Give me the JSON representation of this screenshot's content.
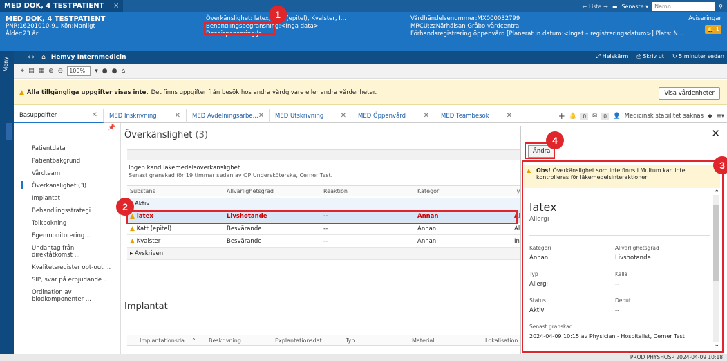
{
  "topbar": {
    "patient_tab": "MED DOK, 4 TESTPATIENT",
    "close": "×",
    "lista": "← Lista →",
    "senaste": "Senaste ▾",
    "search_placeholder": "Namn"
  },
  "header": {
    "patient_name": "MED DOK, 4 TESTPATIENT",
    "pnr": "PNR:16201010-9,, Kön:Manligt",
    "age": "Ålder:23 år",
    "allergy_line": "Överkänslighet: latex, Katt (epitel), Kvalster, I...",
    "treatment": "Behandlingsbegränsning:<Inga data>",
    "dose": "Dosdispensering:Ja",
    "visit_no": "Vårdhändelsenummer:MX000032799",
    "mrcu": "MRCU:zzNärhälsan Gråbo vårdcentral",
    "prereg": "Förhandsregistrering öppenvård [Planerat in.datum:<Inget – registreringsdatum>] Plats: N...",
    "aviseringar": "Aviseringar",
    "notif_count": "1"
  },
  "appbar": {
    "title": "Hemvy Internmedicin",
    "menu": "Meny",
    "helskarm": "Helskärm",
    "skriv_ut": "Skriv ut",
    "updated": "5 minuter sedan"
  },
  "toolbar": {
    "zoom": "100%"
  },
  "warning": {
    "bold": "Alla tillgängliga uppgifter visas inte.",
    "text": "Det finns uppgifter från besök hos andra vårdgivare eller andra vårdenheter.",
    "button": "Visa vårdenheter"
  },
  "tabs": [
    {
      "label": "Basuppgifter"
    },
    {
      "label": "MED Inskrivning"
    },
    {
      "label": "MED Avdelningsarbe..."
    },
    {
      "label": "MED Utskrivning"
    },
    {
      "label": "MED Öppenvård"
    },
    {
      "label": "MED Teambesök"
    }
  ],
  "tab_tools": {
    "plus": "+",
    "count1": "0",
    "count2": "0",
    "stability": "Medicinsk stabilitet saknas"
  },
  "sidebar": [
    "Patientdata",
    "Patientbakgrund",
    "Vårdteam",
    "Överkänslighet (3)",
    "Implantat",
    "Behandlingsstrategi",
    "Tolkbokning",
    "Egenmonitorering ...",
    "Undantag från",
    "direktåtkomst ...",
    "Kvalitetsregister opt-out ...",
    "SIP, svar på erbjudande ...",
    "Ordination av",
    "blodkomponenter ..."
  ],
  "main": {
    "title": "Överkänslighet",
    "count": "(3)",
    "no_med": "Ingen känd läkemedelsöverkänslighet",
    "reviewed": "Senast granskad för 19 timmar sedan av OP Undersköterska, Cerner Test.",
    "headers": [
      "Substans",
      "Allvarlighetsgrad",
      "Reaktion",
      "Kategori",
      "Ty"
    ],
    "group_active": "Aktiv",
    "rows": [
      {
        "sub": "latex",
        "sev": "Livshotande",
        "reac": "--",
        "cat": "Annan",
        "t": "Al"
      },
      {
        "sub": "Katt (epitel)",
        "sev": "Besvärande",
        "reac": "--",
        "cat": "Annan",
        "t": "Al"
      },
      {
        "sub": "Kvalster",
        "sev": "Besvärande",
        "reac": "--",
        "cat": "Annan",
        "t": "Int"
      }
    ],
    "group_closed": "Avskriven",
    "implant_title": "Implantat",
    "implant_headers": [
      "Implantationsda...",
      "Beskrivning",
      "Explantationsdat...",
      "Typ",
      "Material",
      "Lokalisation"
    ]
  },
  "panel": {
    "close": "✕",
    "andra": "Ändra",
    "warn_bold": "Obs!",
    "warn_text": "Överkänslighet som inte finns i Multum kan inte kontrolleras för läkemedelsinteraktioner",
    "title": "latex",
    "subtitle": "Allergi",
    "kategori_lbl": "Kategori",
    "kategori": "Annan",
    "allv_lbl": "Allvarlighetsgrad",
    "allv": "Livshotande",
    "typ_lbl": "Typ",
    "typ": "Allergi",
    "kalla_lbl": "Källa",
    "kalla": "--",
    "status_lbl": "Status",
    "status": "Aktiv",
    "debut_lbl": "Debut",
    "debut": "--",
    "granskad_lbl": "Senast granskad",
    "granskad": "2024-04-09 10:15 av Physician - Hospitalist, Cerner Test"
  },
  "status_bar": "PROD  PHYSHOSP  2024-04-09  10:18",
  "callouts": [
    "1",
    "2",
    "3",
    "4"
  ]
}
